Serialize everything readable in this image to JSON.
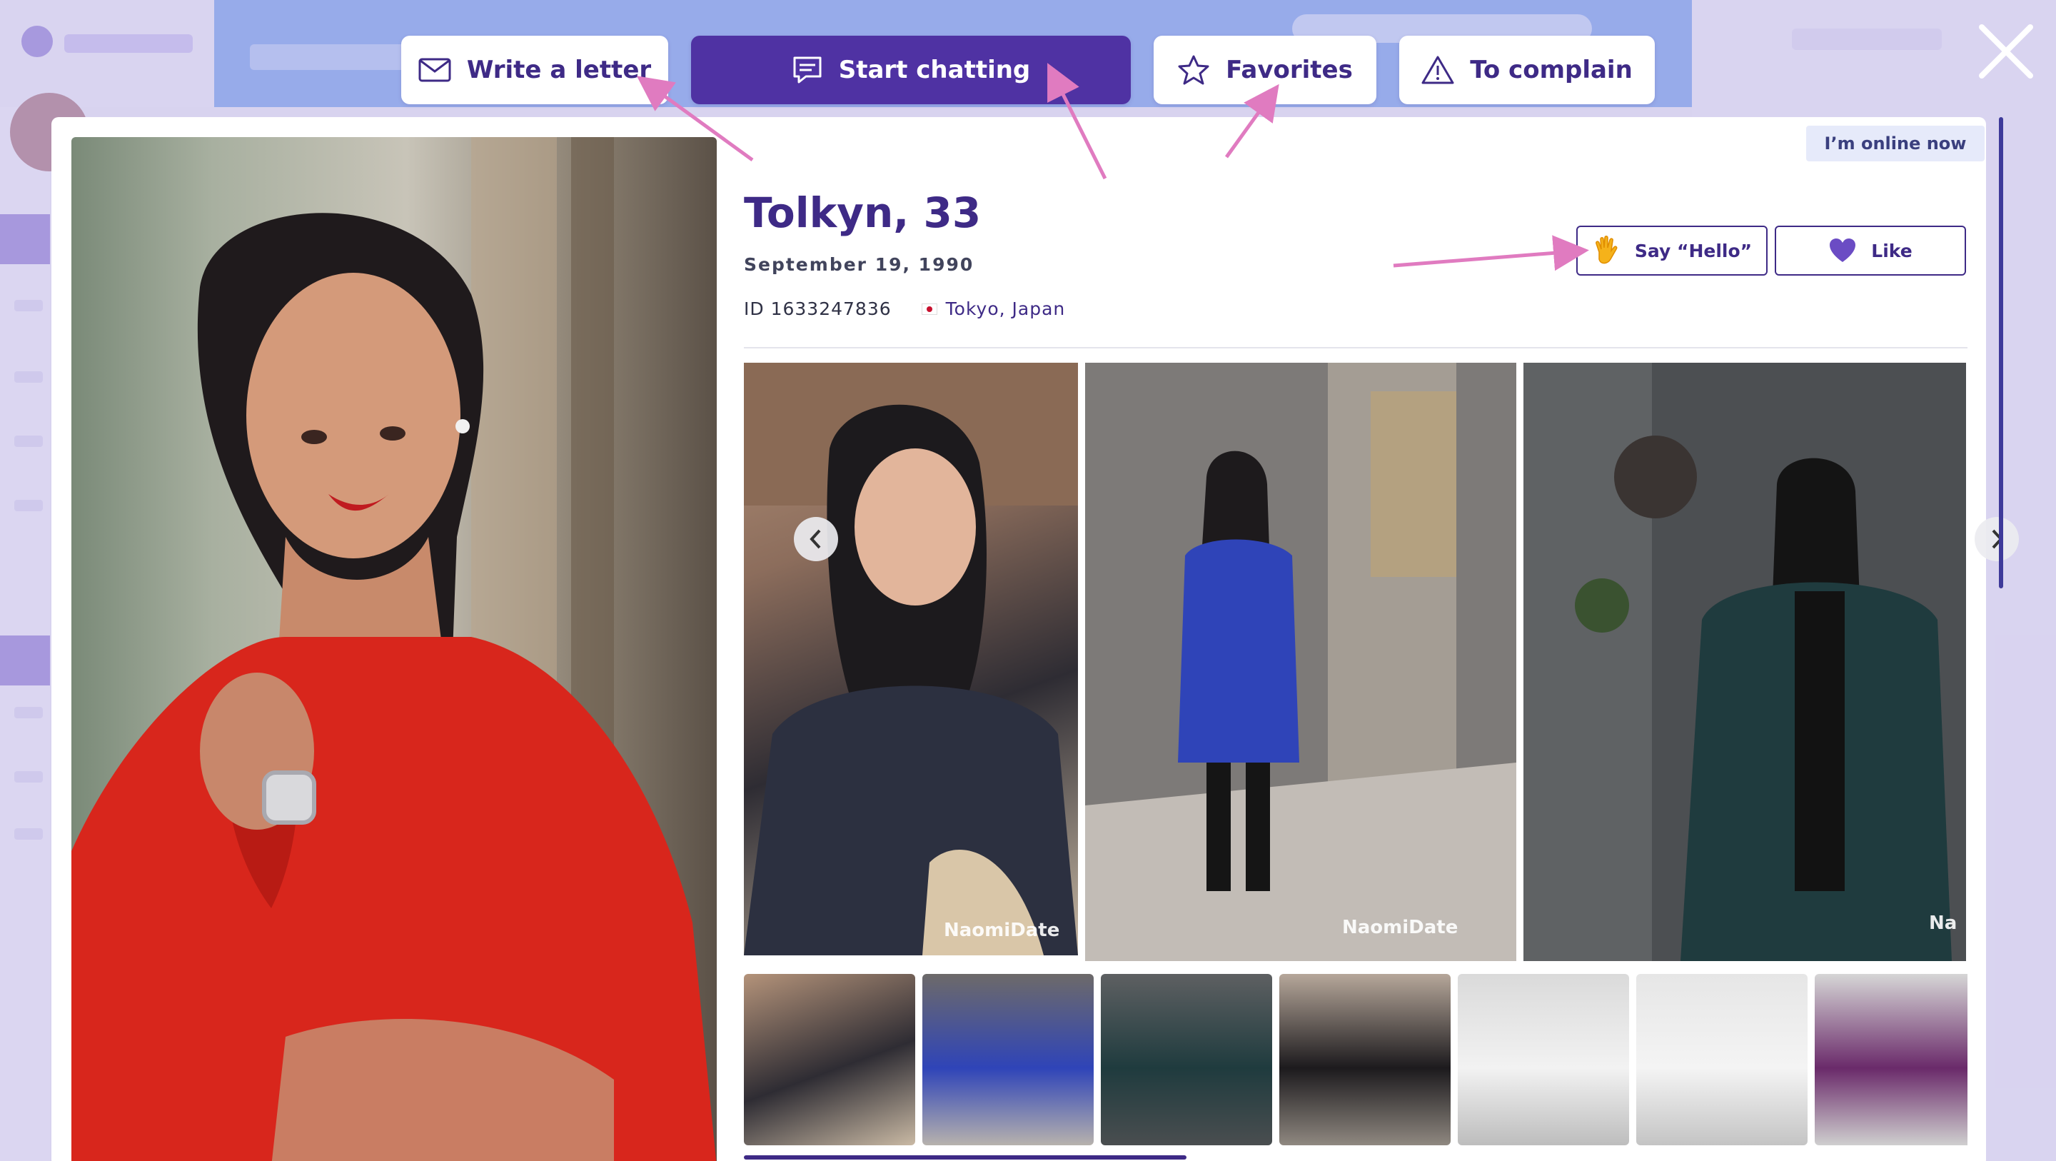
{
  "top_actions": {
    "write_letter": "Write a letter",
    "start_chatting": "Start chatting",
    "favorites": "Favorites",
    "complain": "To complain"
  },
  "profile": {
    "online_status": "I’m online now",
    "name_age": "Tolkyn, 33",
    "birthdate": "September 19, 1990",
    "id": "ID 1633247836",
    "location": "Tokyo, Japan"
  },
  "actions": {
    "say_hello": "Say “Hello”",
    "like": "Like"
  },
  "gallery": {
    "watermark": "NaomiDate",
    "watermark_cut": "Na",
    "photo_count": 3,
    "thumbnail_count": 7
  },
  "icons": {
    "letter": "envelope-icon",
    "chat": "chat-bubble-icon",
    "favorites": "star-icon",
    "complain": "warning-icon",
    "close": "close-icon",
    "hello": "waving-hand-icon",
    "like": "heart-icon"
  },
  "colors": {
    "brand": "#4f32a3",
    "text_primary": "#3e2a86",
    "annotation_arrow": "#e07bc0",
    "online_badge_bg": "#e6eafa"
  }
}
